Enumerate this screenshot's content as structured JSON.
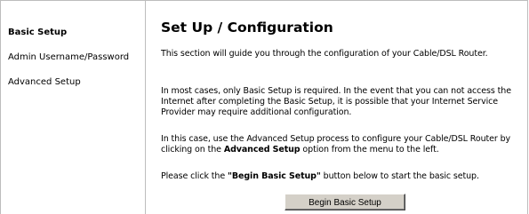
{
  "sidebar": {
    "items": [
      {
        "label": "Basic Setup",
        "active": true
      },
      {
        "label": "Admin Username/Password",
        "active": false
      },
      {
        "label": "Advanced Setup",
        "active": false
      }
    ]
  },
  "main": {
    "title": "Set Up / Configuration",
    "p1": "This section will guide you through the configuration of your Cable/DSL Router.",
    "p2": "In most cases, only Basic Setup is required. In the event that you can not access the Internet after completing the Basic Setup, it is possible that your Internet Service Provider may require additional configuration.",
    "p3_before": "In this case, use the Advanced Setup process to configure your Cable/DSL Router by clicking on the ",
    "p3_bold": "Advanced Setup",
    "p3_after": " option from the menu to the left.",
    "p4_before": "Please click the ",
    "p4_bold": "\"Begin Basic Setup\"",
    "p4_after": " button below to start the basic setup.",
    "button_label": "Begin Basic Setup"
  }
}
